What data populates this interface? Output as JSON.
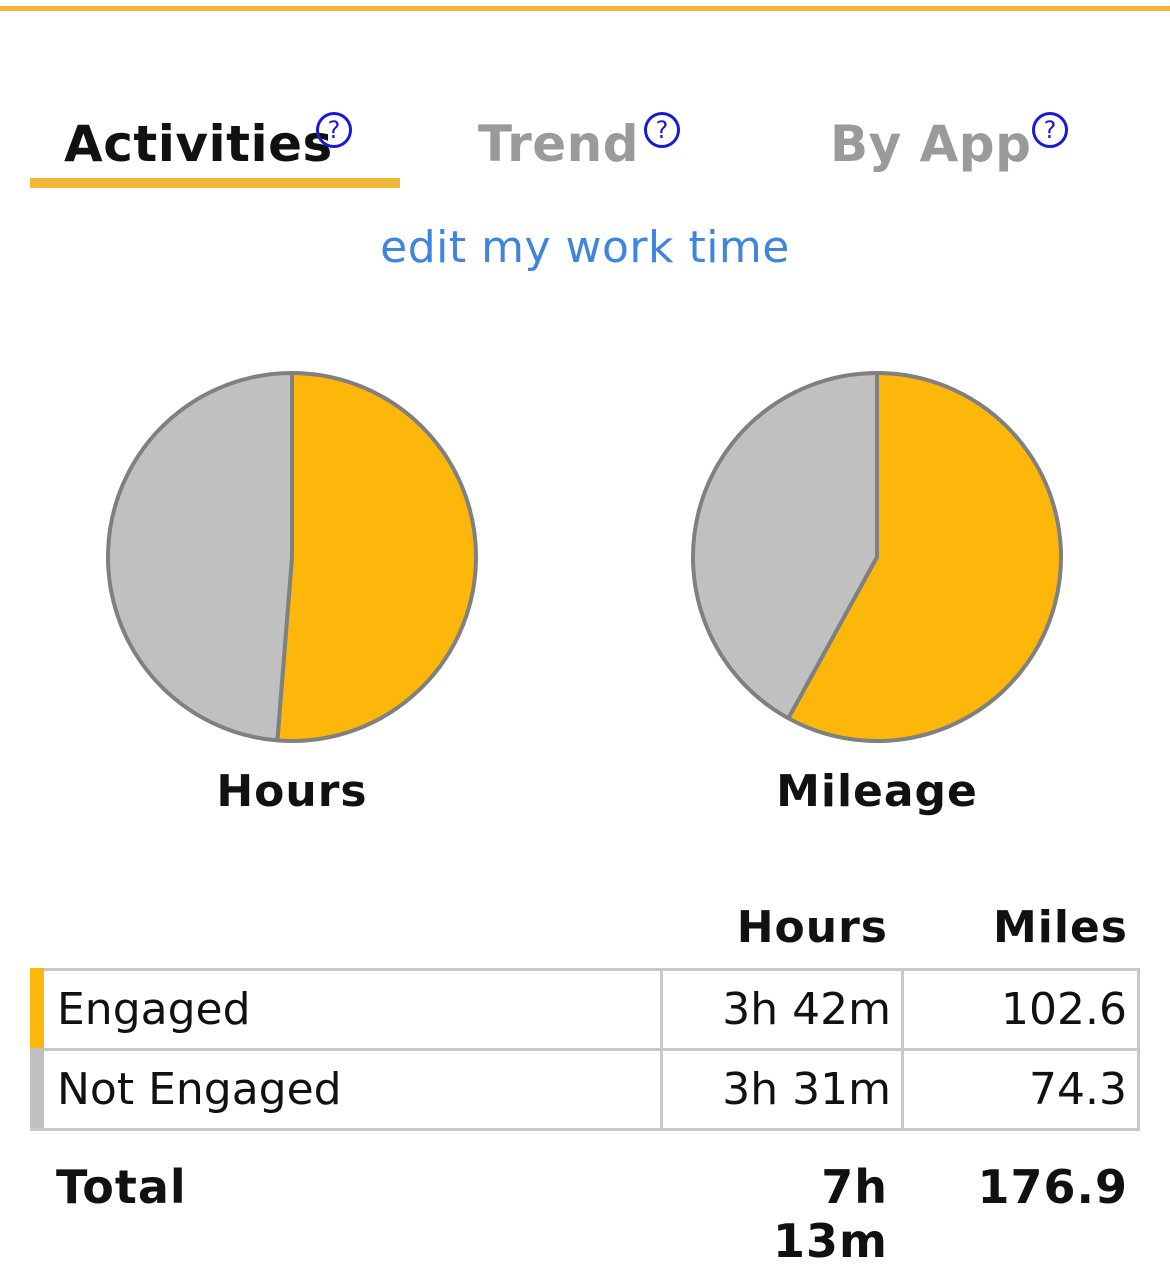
{
  "colors": {
    "accent": "#f2b736",
    "engaged": "#fdb70a",
    "not_engaged": "#c0c0c0",
    "link": "#3f85dd",
    "help": "#1a1ad0"
  },
  "tabs": [
    {
      "label": "Activities",
      "active": true,
      "help_icon": "question-circle-icon"
    },
    {
      "label": "Trend",
      "active": false,
      "help_icon": "question-circle-icon"
    },
    {
      "label": "By App",
      "active": false,
      "help_icon": "question-circle-icon"
    }
  ],
  "help_glyph": "?",
  "edit_link": "edit my work time",
  "chart_data": [
    {
      "type": "pie",
      "title": "Hours",
      "slices": [
        {
          "name": "Engaged",
          "value": 222
        },
        {
          "name": "Not Engaged",
          "value": 211
        }
      ]
    },
    {
      "type": "pie",
      "title": "Mileage",
      "slices": [
        {
          "name": "Engaged",
          "value": 102.6
        },
        {
          "name": "Not Engaged",
          "value": 74.3
        }
      ]
    }
  ],
  "table": {
    "headers": {
      "hours": "Hours",
      "miles": "Miles"
    },
    "rows": [
      {
        "label": "Engaged",
        "hours": "3h 42m",
        "miles": "102.6"
      },
      {
        "label": "Not Engaged",
        "hours": "3h 31m",
        "miles": "74.3"
      }
    ],
    "total": {
      "label": "Total",
      "hours": "7h 13m",
      "miles": "176.9"
    }
  }
}
